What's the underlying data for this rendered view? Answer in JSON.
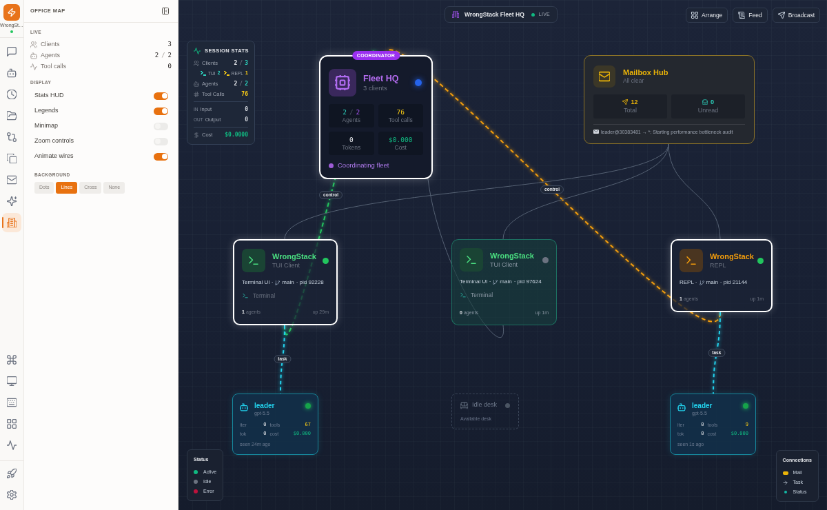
{
  "rail": {
    "brand": {
      "label": "WrongSt…",
      "online": true
    },
    "items": [
      {
        "selected": false
      },
      {
        "selected": false
      },
      {
        "selected": false
      },
      {
        "selected": false
      },
      {
        "selected": false
      },
      {
        "selected": false
      },
      {
        "selected": false
      },
      {
        "selected": false
      },
      {
        "selected": true
      }
    ],
    "tools": [
      {
        "selected": false
      },
      {
        "selected": false
      },
      {
        "selected": false
      },
      {
        "selected": false
      },
      {
        "selected": false
      }
    ],
    "footer": [
      {
        "selected": false
      },
      {
        "selected": false
      }
    ]
  },
  "office_map": {
    "title": "OFFICE MAP",
    "live": {
      "heading": "LIVE",
      "rows": [
        {
          "label": "Clients",
          "value": "3"
        },
        {
          "label": "Agents",
          "value": "2",
          "separator": "/",
          "total": "2"
        },
        {
          "label": "Tool calls",
          "value": "0"
        }
      ]
    },
    "display": {
      "heading": "DISPLAY",
      "toggles": [
        {
          "label": "Stats HUD",
          "on": true
        },
        {
          "label": "Legends",
          "on": true
        },
        {
          "label": "Minimap",
          "on": false
        },
        {
          "label": "Zoom controls",
          "on": false
        },
        {
          "label": "Animate wires",
          "on": true
        }
      ]
    },
    "background": {
      "heading": "BACKGROUND",
      "options": [
        {
          "label": "Dots",
          "selected": false
        },
        {
          "label": "Lines",
          "selected": true
        },
        {
          "label": "Cross",
          "selected": false
        },
        {
          "label": "None",
          "selected": false
        }
      ]
    }
  },
  "canvas": {
    "header": {
      "title": "WrongStack Fleet HQ",
      "status": "LIVE",
      "live": true
    },
    "toolbar": [
      {
        "label": "Arrange"
      },
      {
        "label": "Feed"
      },
      {
        "label": "Broadcast"
      }
    ],
    "session_stats": {
      "title": "SESSION STATS",
      "groups": [
        [
          {
            "kind": "ratio",
            "label": "Clients",
            "value": "2",
            "separator": "/",
            "total": "3"
          },
          {
            "kind": "breakdown",
            "items": [
              {
                "label": "TUI",
                "value": "2",
                "color": "#2dd4bf"
              },
              {
                "label": "REPL",
                "value": "1",
                "color": "#facc15"
              }
            ]
          },
          {
            "kind": "ratio",
            "label": "Agents",
            "value": "2",
            "separator": "/",
            "total": "2"
          },
          {
            "kind": "count",
            "label": "Tool Calls",
            "value": "76"
          }
        ],
        [
          {
            "kind": "io",
            "prefix": "IN",
            "label": "Input",
            "value": "0"
          },
          {
            "kind": "io",
            "prefix": "OUT",
            "label": "Output",
            "value": "0"
          }
        ],
        [
          {
            "kind": "cost",
            "label": "Cost",
            "value": "$0.0000"
          }
        ]
      ]
    },
    "nodes": [
      {
        "kind": "coordinator",
        "badge": "COORDINATOR",
        "title": "Fleet HQ",
        "subtitle": "3 clients",
        "color": "#2563eb",
        "highlighted": true,
        "stats": [
          {
            "value": "2",
            "separator": "/",
            "total": "2",
            "label": "Agents"
          },
          {
            "value": "76",
            "label": "Tool calls"
          },
          {
            "value": "0",
            "label": "Tokens"
          },
          {
            "value": "$0.000",
            "label": "Cost"
          }
        ],
        "footer": "Coordinating fleet"
      },
      {
        "kind": "mailbox",
        "title": "Mailbox Hub",
        "subtitle": "All clear",
        "stats": [
          {
            "value": "12",
            "label": "Total"
          },
          {
            "value": "0",
            "label": "Unread"
          }
        ],
        "last_message": "leader@30383481 → *: Starting performance bottleneck audit"
      },
      {
        "kind": "tui",
        "title": "WrongStack",
        "subtitle": "TUI Client",
        "color": "#22c55e",
        "highlighted": true,
        "meta": "Terminal UI ·",
        "branch": "main",
        "pid": "· pid 92228",
        "tag": "Terminal",
        "agents_count": "1",
        "agents_label": "agents",
        "uptime": "up 29m"
      },
      {
        "kind": "tui",
        "title": "WrongStack",
        "subtitle": "TUI Client",
        "color": "#6b7280",
        "highlighted": false,
        "meta": "Terminal UI ·",
        "branch": "main",
        "pid": "· pid 97624",
        "tag": "Terminal",
        "agents_count": "0",
        "agents_label": "agents",
        "uptime": "up 1m"
      },
      {
        "kind": "repl",
        "title": "WrongStack",
        "subtitle": "REPL",
        "color": "#22c55e",
        "highlighted": true,
        "meta": "REPL ·",
        "branch": "main",
        "pid": "· pid 21144",
        "agents_count": "1",
        "agents_label": "agents",
        "uptime": "up 1m"
      },
      {
        "kind": "agent",
        "title": "leader",
        "model": "gpt-5.5",
        "color": "#16a34a",
        "metrics": [
          {
            "label": "iter",
            "value": "0"
          },
          {
            "label": "tools",
            "value": "67"
          },
          {
            "label": "tok",
            "value": "0"
          },
          {
            "label": "cost",
            "value": "$0.000"
          }
        ],
        "seen": "seen 24m ago"
      },
      {
        "kind": "desk",
        "title": "Idle desk",
        "subtitle": "Available desk",
        "color": "#4b5563"
      },
      {
        "kind": "agent",
        "title": "leader",
        "model": "gpt-5.5",
        "color": "#16a34a",
        "metrics": [
          {
            "label": "iter",
            "value": "0"
          },
          {
            "label": "tools",
            "value": "9"
          },
          {
            "label": "tok",
            "value": "0"
          },
          {
            "label": "cost",
            "value": "$0.000"
          }
        ],
        "seen": "seen 1s ago"
      }
    ],
    "wires": [
      {
        "kind": "control",
        "label": "control",
        "color": "#22c55e"
      },
      {
        "kind": "control",
        "label": "control",
        "color": "#f59e0b"
      },
      {
        "kind": "task",
        "label": "task",
        "color": "#22d3ee"
      },
      {
        "kind": "task",
        "label": "task",
        "color": "#22d3ee"
      },
      {
        "kind": "link",
        "color": "#566274"
      },
      {
        "kind": "link",
        "color": "#566274"
      },
      {
        "kind": "link",
        "color": "#566274"
      },
      {
        "kind": "link",
        "color": "#566274"
      }
    ],
    "status_legend": {
      "title": "Status",
      "items": [
        {
          "label": "Active",
          "color": "#10b981"
        },
        {
          "label": "Idle",
          "color": "#6b7280"
        },
        {
          "label": "Error",
          "color": "#be123c"
        }
      ]
    },
    "connections_legend": {
      "title": "Connections",
      "items": [
        {
          "kind": "mail",
          "label": "Mail"
        },
        {
          "kind": "task",
          "label": "Task"
        },
        {
          "kind": "status",
          "label": "Status"
        }
      ]
    }
  }
}
